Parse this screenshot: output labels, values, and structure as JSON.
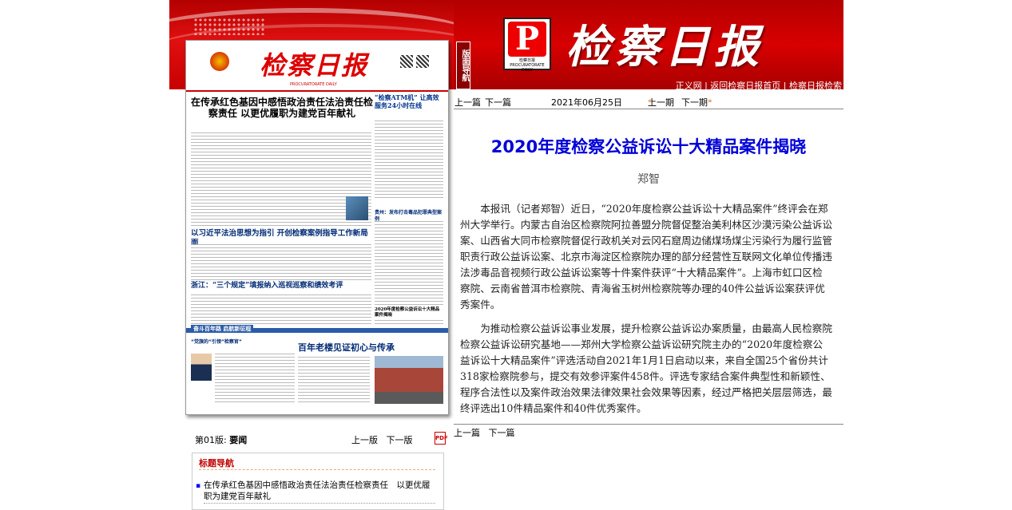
{
  "masthead": {
    "title": "检察日报",
    "logo_letter": "P",
    "logo_caption": "检察日报 PROCURATORATE DAILY",
    "nav_tab": "版面导航",
    "links": [
      "正义网",
      "返回检察日报首页",
      "检察日报检索"
    ]
  },
  "paper_thumb": {
    "title": "检察日报",
    "subline": "PROCURATORATE DAILY",
    "headline_main": "在传承红色基因中感悟政治责任法治责任检察责任 以更优履职为建党百年献礼",
    "headline_side": "“检察ATM机” 让高效服务24小时在线",
    "headline_2": "以习近平法治思想为指引 开创检察案例指导工作新局面",
    "headline_3": "浙江：“三个规定”填报纳入巡视巡察和绩效考评",
    "side_2": "贵州：发布打击毒品犯罪典型案例",
    "side_3": "2020年度检察公益诉讼十大精品案件揭晓",
    "band_tag": "奋斗百年路 启航新征程",
    "small_head": "“党旗的“引领”检察官”",
    "headline_4": "百年老楼见证初心与传承"
  },
  "toolbar": {
    "prev": "上一篇",
    "next": "下一篇",
    "date": "2021年06月25日",
    "prev_issue": "上一期",
    "next_issue": "下一期"
  },
  "article": {
    "title": "2020年度检察公益诉讼十大精品案件揭晓",
    "author": "郑智",
    "paragraphs": [
      "本报讯（记者郑智）近日，“2020年度检察公益诉讼十大精品案件”终评会在郑州大学举行。内蒙古自治区检察院阿拉善盟分院督促整治美利林区沙漠污染公益诉讼案、山西省大同市检察院督促行政机关对云冈石窟周边储煤场煤尘污染行为履行监管职责行政公益诉讼案、北京市海淀区检察院办理的部分经营性互联网文化单位传播违法涉毒品音视频行政公益诉讼案等十件案件获评“十大精品案件”。上海市虹口区检察院、云南省普洱市检察院、青海省玉树州检察院等办理的40件公益诉讼案获评优秀案件。",
      "为推动检察公益诉讼事业发展，提升检察公益诉讼办案质量，由最高人民检察院检察公益诉讼研究基地——郑州大学检察公益诉讼研究院主办的“2020年度检察公益诉讼十大精品案件”评选活动自2021年1月1日启动以来，来自全国25个省份共计318家检察院参与，提交有效参评案件458件。评选专家结合案件典型性和新颖性、程序合法性以及案件政治效果法律效果社会效果等因素，经过严格把关层层筛选，最终评选出10件精品案件和40件优秀案件。"
    ]
  },
  "bottom_nav": {
    "prev": "上一篇",
    "next": "下一篇"
  },
  "page_bar": {
    "page_label": "第01版:",
    "page_name": "要闻",
    "prev_page": "上一版",
    "next_page": "下一版",
    "pdf_icon": "pdf-icon"
  },
  "headline_nav": {
    "title": "标题导航",
    "items": [
      "在传承红色基因中感悟政治责任法治责任检察责任　以更优履职为建党百年献礼"
    ]
  }
}
